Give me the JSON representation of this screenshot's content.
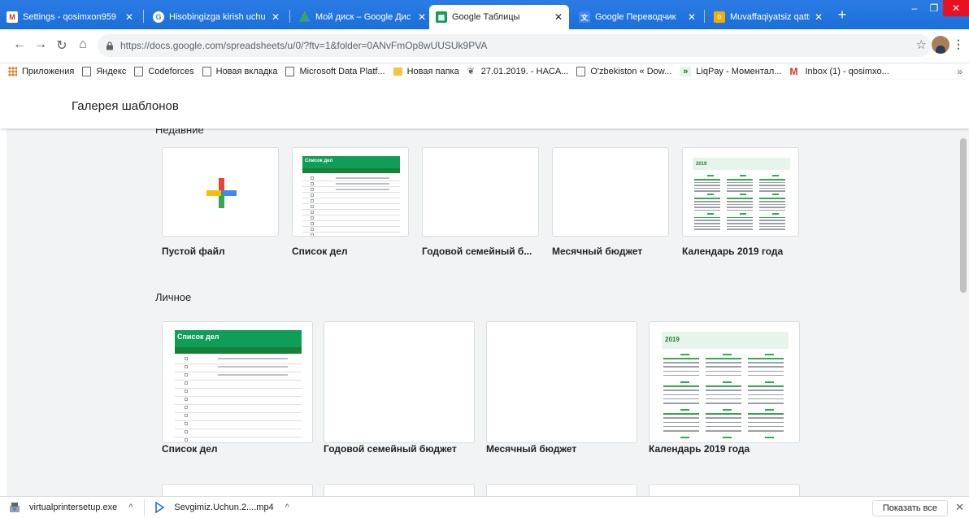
{
  "browser": {
    "tabs": [
      {
        "title": "Settings - qosimxon959",
        "icon": "gmail-icon"
      },
      {
        "title": "Hisobingizga kirish uchu",
        "icon": "google-icon"
      },
      {
        "title": "Мой диск – Google Дис",
        "icon": "drive-icon"
      },
      {
        "title": "Google Таблицы",
        "icon": "sheets-icon",
        "active": true
      },
      {
        "title": "Google Переводчик",
        "icon": "translate-icon"
      },
      {
        "title": "Muvaffaqiyatsiz qattiq d",
        "icon": "site-icon"
      }
    ],
    "url": "https://docs.google.com/spreadsheets/u/0/?ftv=1&folder=0ANvFmOp8wUUSUk9PVA",
    "bookmarks": [
      {
        "label": "Приложения",
        "icon": "apps"
      },
      {
        "label": "Яндекс",
        "icon": "page"
      },
      {
        "label": "Codeforces",
        "icon": "page"
      },
      {
        "label": "Новая вкладка",
        "icon": "page"
      },
      {
        "label": "Microsoft Data Platf...",
        "icon": "page"
      },
      {
        "label": "Новая папка",
        "icon": "folder"
      },
      {
        "label": "27.01.2019. - HACA...",
        "icon": "bird"
      },
      {
        "label": "O'zbekiston « Dow...",
        "icon": "page"
      },
      {
        "label": "LiqPay - Моментал...",
        "icon": "green"
      },
      {
        "label": "Inbox (1) - qosimxo...",
        "icon": "gmail"
      }
    ],
    "more": "»"
  },
  "header": {
    "title": "Галерея шаблонов"
  },
  "sections": [
    {
      "title": "Недавние",
      "cards": [
        {
          "label": "Пустой файл",
          "thumb": "plus"
        },
        {
          "label": "Список дел",
          "thumb": "todo"
        },
        {
          "label": "Годовой семейный б...",
          "thumb": "blank"
        },
        {
          "label": "Месячный бюджет",
          "thumb": "blank"
        },
        {
          "label": "Календарь 2019 года",
          "thumb": "calendar"
        }
      ]
    },
    {
      "title": "Личное",
      "cards": [
        {
          "label": "Список дел",
          "thumb": "todo"
        },
        {
          "label": "Годовой семейный бюджет",
          "thumb": "blank"
        },
        {
          "label": "Месячный бюджет",
          "thumb": "blank"
        },
        {
          "label": "Календарь 2019 года",
          "thumb": "calendar"
        }
      ]
    }
  ],
  "thumbs": {
    "todo_title": "Список дел",
    "calendar_year": "2019"
  },
  "downloads": [
    {
      "name": "virtualprintersetup.exe",
      "icon": "installer-icon"
    },
    {
      "name": "Sevgimiz.Uchun.2....mp4",
      "icon": "play-icon"
    }
  ],
  "downloads_show_all": "Показать все",
  "colors": {
    "tab_strip": "#1a73e8",
    "sheets_green": "#0f9d58",
    "plus_red": "#ea4335",
    "plus_blue": "#4285f4",
    "plus_yellow": "#fbbc04",
    "plus_green": "#34a853"
  }
}
